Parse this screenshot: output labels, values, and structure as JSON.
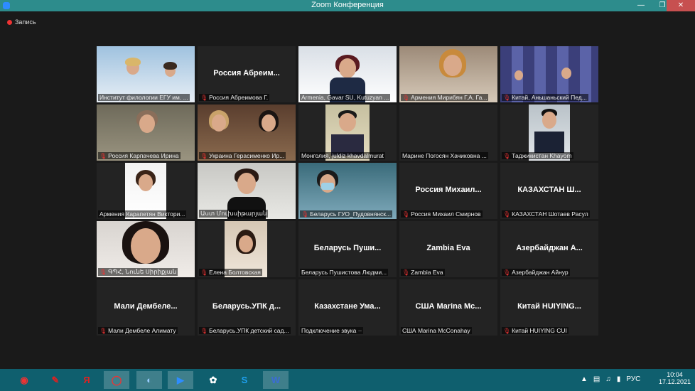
{
  "window": {
    "title": "Zoom Конференция"
  },
  "recording": {
    "label": "Запись"
  },
  "tiles": [
    {
      "label": "Институт филологии ЕГУ им. ...",
      "big": "",
      "muted": false,
      "active": true
    },
    {
      "label": "Россия Абреимова Г.",
      "big": "Россия  Абреим...",
      "muted": true
    },
    {
      "label": "Armenia, Gavar SU, Kutuzyan ...",
      "big": "",
      "muted": false
    },
    {
      "label": "Армения Мирибян Г.А. Га...",
      "big": "",
      "muted": true
    },
    {
      "label": "Китай,  Аньшаньский Пед...",
      "big": "",
      "muted": true
    },
    {
      "label": "Россия Карпачева Ирина",
      "big": "",
      "muted": true
    },
    {
      "label": "Украина Герасименко Ир...",
      "big": "",
      "muted": true
    },
    {
      "label": "Монголия, juldiz khavdalmurat",
      "big": "",
      "muted": false
    },
    {
      "label": "Марине Погосян Хачиковна ...",
      "big": "",
      "muted": false
    },
    {
      "label": "Таджикистан Khayom",
      "big": "",
      "muted": true
    },
    {
      "label": "Армения Карапетян Виктори...",
      "big": "",
      "muted": false
    },
    {
      "label": "Աստ Մուխսիթարյան",
      "big": "",
      "muted": false
    },
    {
      "label": "Беларусь ГУО_Пудовнянск...",
      "big": "",
      "muted": true
    },
    {
      "label": "Россия Михаил Смирнов",
      "big": "Россия  Михаил...",
      "muted": true
    },
    {
      "label": "КАЗАХСТАН Шотаев Расул",
      "big": "КАЗАХСТАН  Ш...",
      "muted": true
    },
    {
      "label": "ԳՊՀ, Նունե Սիրիքյան",
      "big": "",
      "muted": true
    },
    {
      "label": "Елена Болтовская",
      "big": "",
      "muted": true
    },
    {
      "label": "Беларусь Пушистова Людми...",
      "big": "Беларусь  Пуши...",
      "muted": false
    },
    {
      "label": "Zambia Eva",
      "big": "Zambia Eva",
      "muted": true
    },
    {
      "label": "Азербайджан Айнур",
      "big": "Азербайджан  А...",
      "muted": true
    },
    {
      "label": "Мали Дембеле Алимату",
      "big": "Мали  Дембеле...",
      "muted": true
    },
    {
      "label": "Беларусь.УПК детский сад...",
      "big": "Беларусь.УПК  д...",
      "muted": true
    },
    {
      "label": "Подключение звука ··",
      "big": "Казахстане  Ума...",
      "muted": false
    },
    {
      "label": "США Marina McConahay",
      "big": "США  Marina  Mc...",
      "muted": false
    },
    {
      "label": "Китай HUIYING CUI",
      "big": "Китай  HUIYING...",
      "muted": true
    }
  ],
  "taskbar": {
    "apps": [
      "opera-red",
      "acrobat",
      "yandex",
      "opera",
      "snipping",
      "zoom",
      "paint",
      "skype",
      "word"
    ],
    "lang": "РУС",
    "time": "10:04",
    "date": "17.12.2021"
  }
}
